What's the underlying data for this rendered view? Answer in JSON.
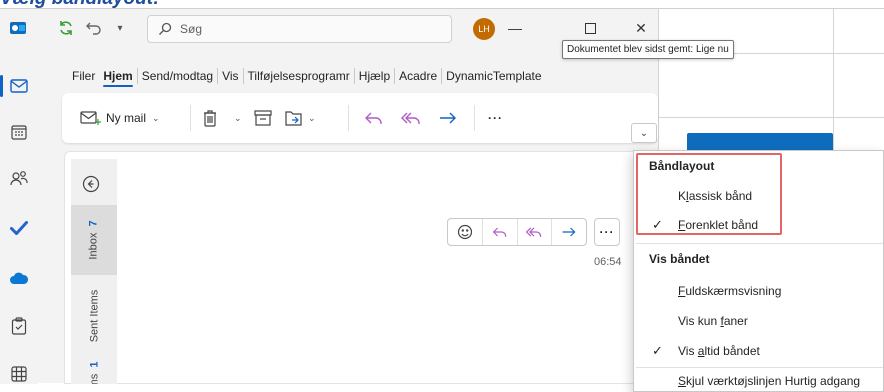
{
  "heading": "Vælg båndlayout:",
  "titlebar": {
    "search_placeholder": "Søg",
    "avatar_initials": "LH",
    "tooltip": "Dokumentet blev sidst gemt: Lige nu"
  },
  "tabs": [
    "Filer",
    "Hjem",
    "Send/modtag",
    "Vis",
    "Tilføjelsesprogramr",
    "Hjælp",
    "Acadre",
    "DynamicTemplate"
  ],
  "ribbon": {
    "new_mail_label": "Ny mail",
    "more_label": "···"
  },
  "folders": {
    "inbox_label": "Inbox",
    "inbox_count": "7",
    "sent_label": "Sent Items",
    "partial_label": "ms",
    "partial_count": "1"
  },
  "message": {
    "more_label": "···",
    "time": "06:54"
  },
  "menu": {
    "section1": "Båndlayout",
    "classic_pre": "K",
    "classic_ul": "l",
    "classic_post": "assisk bånd",
    "simplified_ul": "F",
    "simplified_post": "orenklet bånd",
    "section2": "Vis båndet",
    "fullscreen_ul": "F",
    "fullscreen_post": "uldskærmsvisning",
    "tabs_only_pre": "Vis kun ",
    "tabs_only_ul": "f",
    "tabs_only_post": "aner",
    "always_pre": "Vis ",
    "always_ul": "a",
    "always_post": "ltid båndet",
    "hide_qat_ul": "S",
    "hide_qat_post": "kjul værktøjslinjen Hurtig adgang"
  },
  "colors": {
    "accent": "#1063c4",
    "highlight_border": "#e06666",
    "avatar_bg": "#c26b00"
  }
}
